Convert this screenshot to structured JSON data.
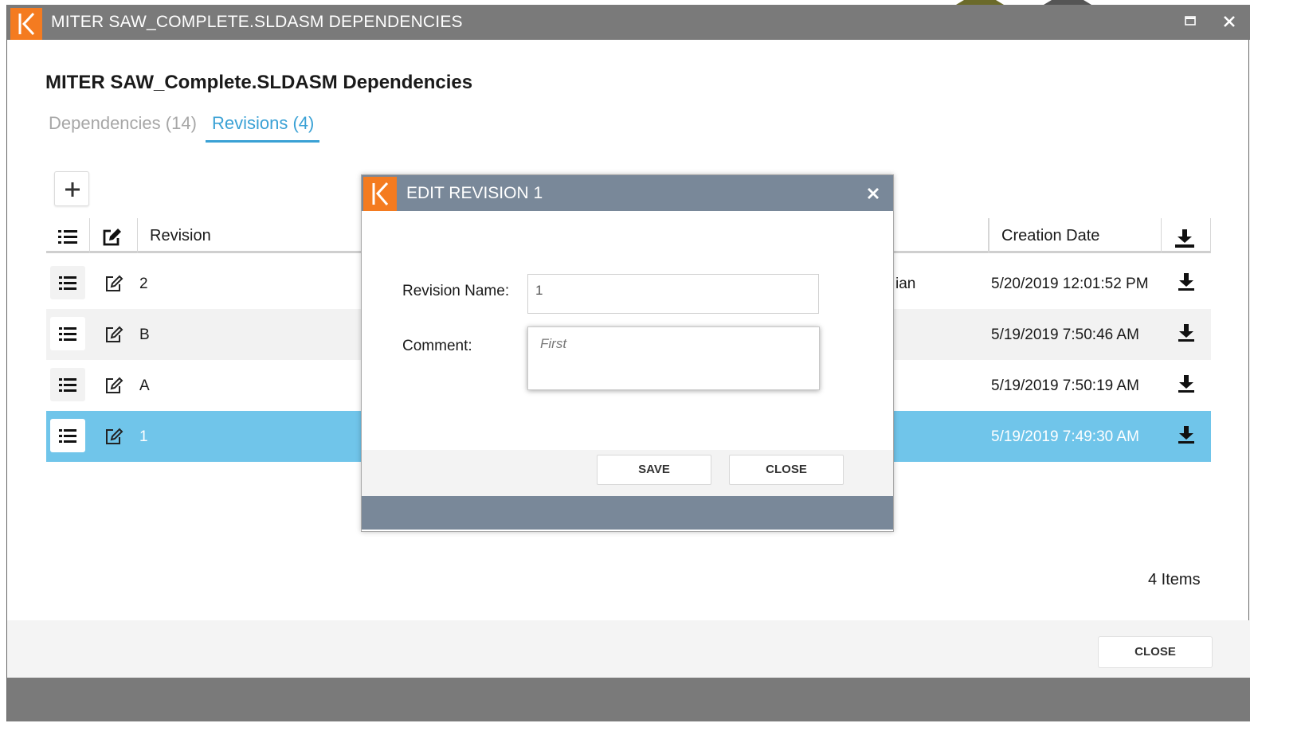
{
  "window": {
    "title": "MITER SAW_COMPLETE.SLDASM DEPENDENCIES",
    "logo_letter": "K",
    "accent_color": "#f47b20",
    "titlebar_color": "#7a7a7a"
  },
  "page": {
    "title": "MITER SAW_Complete.SLDASM Dependencies",
    "tabs": [
      {
        "label": "Dependencies (14)",
        "active": false
      },
      {
        "label": "Revisions (4)",
        "active": true
      }
    ],
    "tab_active_color": "#3aa1d5"
  },
  "toolbar": {
    "add_icon": "plus-icon"
  },
  "grid": {
    "headers": {
      "list_icon": "list-icon",
      "edit_icon": "edit-icon",
      "revision": "Revision",
      "creation_date": "Creation Date",
      "download_icon": "download-icon"
    },
    "rows": [
      {
        "revision": "2",
        "partial_text": "ian",
        "creation_date": "5/20/2019 12:01:52 PM",
        "selected": false
      },
      {
        "revision": "B",
        "partial_text": "",
        "creation_date": "5/19/2019 7:50:46 AM",
        "selected": false
      },
      {
        "revision": "A",
        "partial_text": "",
        "creation_date": "5/19/2019 7:50:19 AM",
        "selected": false
      },
      {
        "revision": "1",
        "partial_text": "",
        "creation_date": "5/19/2019 7:49:30 AM",
        "selected": true
      }
    ],
    "selected_color": "#70c5ea",
    "items_count": "4 Items"
  },
  "footer": {
    "close_label": "CLOSE"
  },
  "modal": {
    "title": "EDIT REVISION 1",
    "titlebar_color": "#798899",
    "revision_name_label": "Revision Name:",
    "revision_name_value": "1",
    "comment_label": "Comment:",
    "comment_value": "First",
    "save_label": "SAVE",
    "close_label": "CLOSE"
  }
}
